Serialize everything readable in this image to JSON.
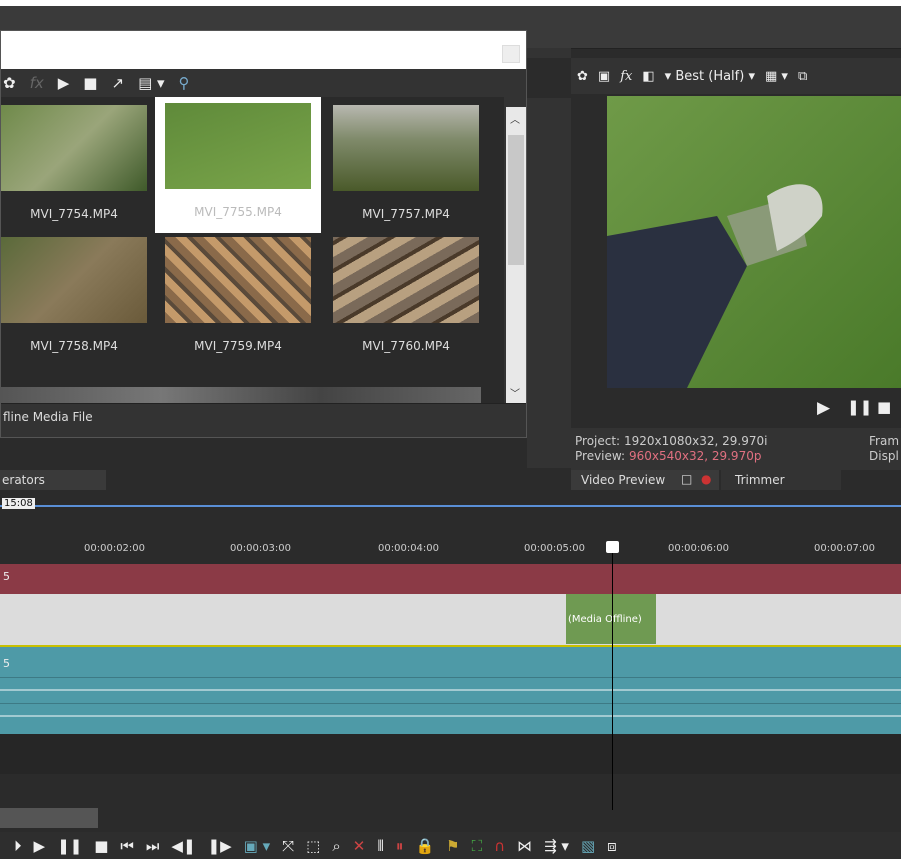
{
  "media_window": {
    "status": "fline Media File",
    "thumbs": [
      {
        "name": "MVI_7754.MP4"
      },
      {
        "name": "MVI_7755.MP4"
      },
      {
        "name": "MVI_7757.MP4"
      },
      {
        "name": "MVI_7758.MP4"
      },
      {
        "name": "MVI_7759.MP4"
      },
      {
        "name": "MVI_7760.MP4"
      }
    ]
  },
  "preview": {
    "quality": "Best (Half)",
    "project_label": "Project:",
    "project_value": "1920x1080x32, 29.970i",
    "preview_label": "Preview:",
    "preview_value": "960x540x32, 29.970p",
    "frame_label": "Fram",
    "display_label": "Displ",
    "tab_video_preview": "Video Preview",
    "tab_trimmer": "Trimmer"
  },
  "generators_tab": "erators",
  "timeline": {
    "cursor_time": "15:08",
    "ticks": [
      "00:00:02:00",
      "00:00:03:00",
      "00:00:04:00",
      "00:00:05:00",
      "00:00:06:00",
      "00:00:07:00"
    ],
    "video_track_num": "5",
    "audio_track_num": "5",
    "clip_label": "(Media Offline)"
  }
}
